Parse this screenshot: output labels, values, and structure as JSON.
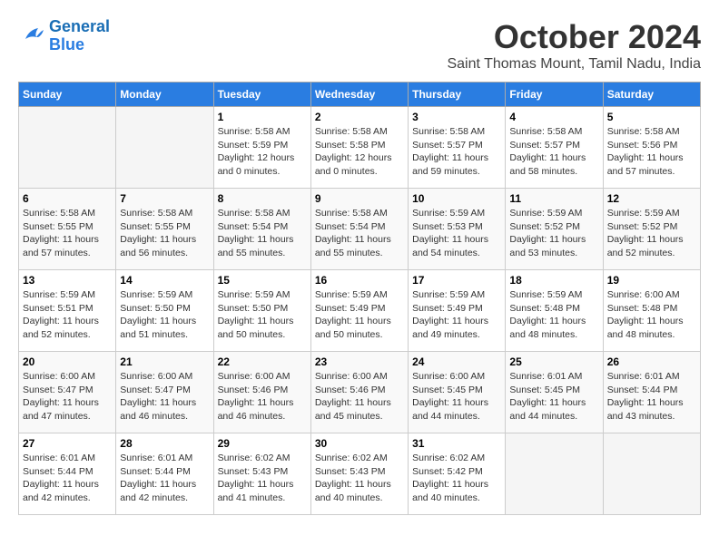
{
  "header": {
    "logo_line1": "General",
    "logo_line2": "Blue",
    "month": "October 2024",
    "location": "Saint Thomas Mount, Tamil Nadu, India"
  },
  "days_of_week": [
    "Sunday",
    "Monday",
    "Tuesday",
    "Wednesday",
    "Thursday",
    "Friday",
    "Saturday"
  ],
  "weeks": [
    [
      {
        "day": "",
        "info": ""
      },
      {
        "day": "",
        "info": ""
      },
      {
        "day": "1",
        "info": "Sunrise: 5:58 AM\nSunset: 5:59 PM\nDaylight: 12 hours\nand 0 minutes."
      },
      {
        "day": "2",
        "info": "Sunrise: 5:58 AM\nSunset: 5:58 PM\nDaylight: 12 hours\nand 0 minutes."
      },
      {
        "day": "3",
        "info": "Sunrise: 5:58 AM\nSunset: 5:57 PM\nDaylight: 11 hours\nand 59 minutes."
      },
      {
        "day": "4",
        "info": "Sunrise: 5:58 AM\nSunset: 5:57 PM\nDaylight: 11 hours\nand 58 minutes."
      },
      {
        "day": "5",
        "info": "Sunrise: 5:58 AM\nSunset: 5:56 PM\nDaylight: 11 hours\nand 57 minutes."
      }
    ],
    [
      {
        "day": "6",
        "info": "Sunrise: 5:58 AM\nSunset: 5:55 PM\nDaylight: 11 hours\nand 57 minutes."
      },
      {
        "day": "7",
        "info": "Sunrise: 5:58 AM\nSunset: 5:55 PM\nDaylight: 11 hours\nand 56 minutes."
      },
      {
        "day": "8",
        "info": "Sunrise: 5:58 AM\nSunset: 5:54 PM\nDaylight: 11 hours\nand 55 minutes."
      },
      {
        "day": "9",
        "info": "Sunrise: 5:58 AM\nSunset: 5:54 PM\nDaylight: 11 hours\nand 55 minutes."
      },
      {
        "day": "10",
        "info": "Sunrise: 5:59 AM\nSunset: 5:53 PM\nDaylight: 11 hours\nand 54 minutes."
      },
      {
        "day": "11",
        "info": "Sunrise: 5:59 AM\nSunset: 5:52 PM\nDaylight: 11 hours\nand 53 minutes."
      },
      {
        "day": "12",
        "info": "Sunrise: 5:59 AM\nSunset: 5:52 PM\nDaylight: 11 hours\nand 52 minutes."
      }
    ],
    [
      {
        "day": "13",
        "info": "Sunrise: 5:59 AM\nSunset: 5:51 PM\nDaylight: 11 hours\nand 52 minutes."
      },
      {
        "day": "14",
        "info": "Sunrise: 5:59 AM\nSunset: 5:50 PM\nDaylight: 11 hours\nand 51 minutes."
      },
      {
        "day": "15",
        "info": "Sunrise: 5:59 AM\nSunset: 5:50 PM\nDaylight: 11 hours\nand 50 minutes."
      },
      {
        "day": "16",
        "info": "Sunrise: 5:59 AM\nSunset: 5:49 PM\nDaylight: 11 hours\nand 50 minutes."
      },
      {
        "day": "17",
        "info": "Sunrise: 5:59 AM\nSunset: 5:49 PM\nDaylight: 11 hours\nand 49 minutes."
      },
      {
        "day": "18",
        "info": "Sunrise: 5:59 AM\nSunset: 5:48 PM\nDaylight: 11 hours\nand 48 minutes."
      },
      {
        "day": "19",
        "info": "Sunrise: 6:00 AM\nSunset: 5:48 PM\nDaylight: 11 hours\nand 48 minutes."
      }
    ],
    [
      {
        "day": "20",
        "info": "Sunrise: 6:00 AM\nSunset: 5:47 PM\nDaylight: 11 hours\nand 47 minutes."
      },
      {
        "day": "21",
        "info": "Sunrise: 6:00 AM\nSunset: 5:47 PM\nDaylight: 11 hours\nand 46 minutes."
      },
      {
        "day": "22",
        "info": "Sunrise: 6:00 AM\nSunset: 5:46 PM\nDaylight: 11 hours\nand 46 minutes."
      },
      {
        "day": "23",
        "info": "Sunrise: 6:00 AM\nSunset: 5:46 PM\nDaylight: 11 hours\nand 45 minutes."
      },
      {
        "day": "24",
        "info": "Sunrise: 6:00 AM\nSunset: 5:45 PM\nDaylight: 11 hours\nand 44 minutes."
      },
      {
        "day": "25",
        "info": "Sunrise: 6:01 AM\nSunset: 5:45 PM\nDaylight: 11 hours\nand 44 minutes."
      },
      {
        "day": "26",
        "info": "Sunrise: 6:01 AM\nSunset: 5:44 PM\nDaylight: 11 hours\nand 43 minutes."
      }
    ],
    [
      {
        "day": "27",
        "info": "Sunrise: 6:01 AM\nSunset: 5:44 PM\nDaylight: 11 hours\nand 42 minutes."
      },
      {
        "day": "28",
        "info": "Sunrise: 6:01 AM\nSunset: 5:44 PM\nDaylight: 11 hours\nand 42 minutes."
      },
      {
        "day": "29",
        "info": "Sunrise: 6:02 AM\nSunset: 5:43 PM\nDaylight: 11 hours\nand 41 minutes."
      },
      {
        "day": "30",
        "info": "Sunrise: 6:02 AM\nSunset: 5:43 PM\nDaylight: 11 hours\nand 40 minutes."
      },
      {
        "day": "31",
        "info": "Sunrise: 6:02 AM\nSunset: 5:42 PM\nDaylight: 11 hours\nand 40 minutes."
      },
      {
        "day": "",
        "info": ""
      },
      {
        "day": "",
        "info": ""
      }
    ]
  ]
}
